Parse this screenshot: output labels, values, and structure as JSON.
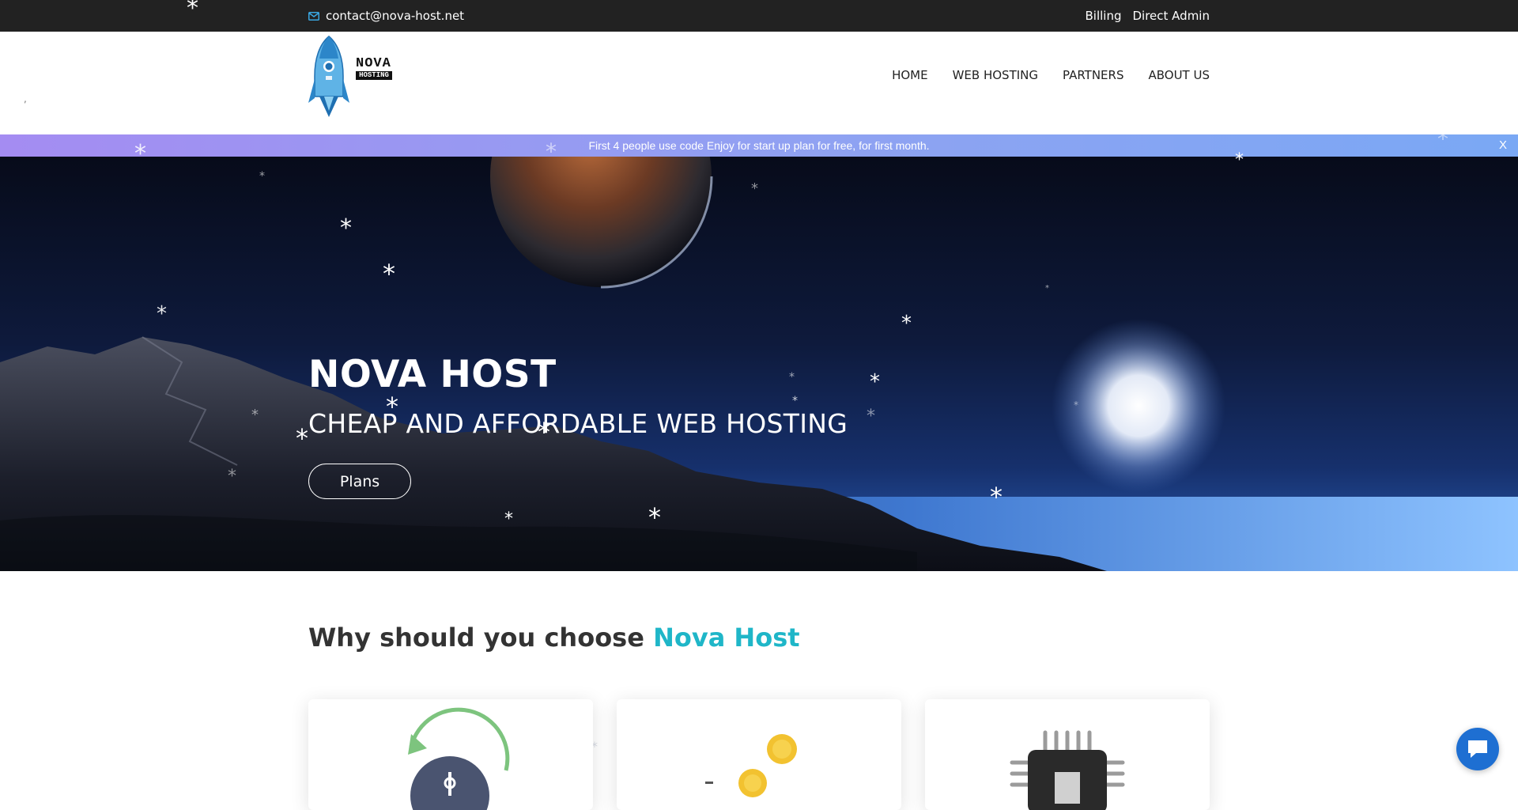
{
  "topbar": {
    "email": "contact@nova-host.net",
    "email_icon": "envelope-icon",
    "links": [
      "Billing",
      "Direct Admin"
    ]
  },
  "header": {
    "logo": {
      "line1": "NOVA",
      "line2": "HOSTING",
      "icon": "rocket-icon"
    },
    "nav": [
      "HOME",
      "WEB HOSTING",
      "PARTNERS",
      "ABOUT US"
    ]
  },
  "promo": {
    "text": "First 4 people use code Enjoy for start up plan for free, for first month.",
    "close": "X"
  },
  "hero": {
    "title": "NOVA HOST",
    "subtitle": "CHEAP AND AFFORDABLE WEB HOSTING",
    "button": "Plans"
  },
  "why": {
    "prefix": "Why should you choose",
    "highlight": "Nova Host"
  },
  "cards": [
    {
      "icon": "clock-refresh-icon"
    },
    {
      "icon": "coins-icon"
    },
    {
      "icon": "cpu-chip-icon"
    }
  ],
  "chat": {
    "icon": "chat-bubble-icon"
  },
  "colors": {
    "accent": "#1fb6c8",
    "topbar": "#222222",
    "promo_start": "#a48cf2",
    "promo_end": "#7aa8f4",
    "chat": "#1e6fd2"
  }
}
